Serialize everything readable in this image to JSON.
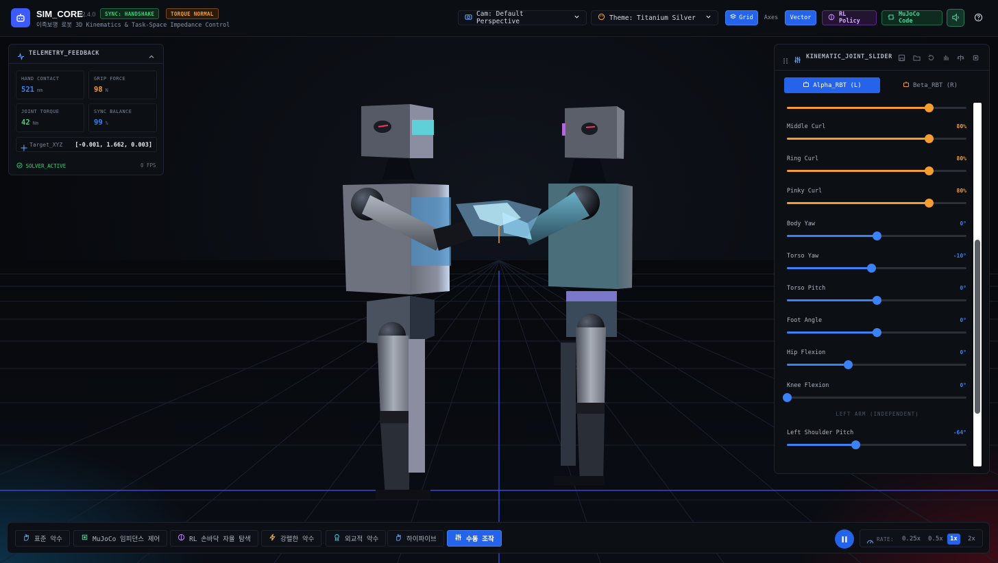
{
  "header": {
    "app_name": "SIM_CORE",
    "version": "v2.4.0",
    "subtitle": "이족보행 로봇 3D Kinematics & Task-Space Impedance Control",
    "sync_badge": "SYNC: HANDSHAKE",
    "torque_badge": "TORQUE NORMAL",
    "camera_select": "Cam: Default Perspective",
    "theme_select": "Theme: Titanium Silver",
    "view_toggles": {
      "grid": "Grid",
      "axes": "Axes",
      "vector": "Vector"
    },
    "rl_policy_button": "RL Policy",
    "mujoco_button": "MuJoCo Code"
  },
  "telemetry": {
    "title": "TELEMETRY_FEEDBACK",
    "metrics": [
      {
        "label": "HAND CONTACT",
        "value": "521",
        "unit": "mm",
        "color": "#3b82f6"
      },
      {
        "label": "GRIP FORCE",
        "value": "98",
        "unit": "N",
        "color": "#f59e2f"
      },
      {
        "label": "JOINT TORQUE",
        "value": "42",
        "unit": "Nm",
        "color": "#34d27a"
      },
      {
        "label": "SYNC BALANCE",
        "value": "99",
        "unit": "%",
        "color": "#3b82f6"
      }
    ],
    "target_label": "Target_XYZ",
    "target_value": "[-0.001, 1.662, 0.003]",
    "solver_status": "SOLVER_ACTIVE",
    "fps": "0 FPS"
  },
  "kinematics": {
    "title": "KINEMATIC_JOINT_SLIDERS",
    "robots": {
      "alpha": "Alpha_RBT (L)",
      "beta": "Beta_RBT (R)"
    },
    "partial_slider": {
      "fraction": 0.79,
      "color": "#f59e2f"
    },
    "sliders": [
      {
        "label": "Middle Curl",
        "value": "80%",
        "fraction": 0.79,
        "color": "#f59e2f"
      },
      {
        "label": "Ring Curl",
        "value": "80%",
        "fraction": 0.79,
        "color": "#f59e2f"
      },
      {
        "label": "Pinky Curl",
        "value": "80%",
        "fraction": 0.79,
        "color": "#f59e2f"
      },
      {
        "label": "Body Yaw",
        "value": "0°",
        "fraction": 0.5,
        "color": "#3b82f6"
      },
      {
        "label": "Torso Yaw",
        "value": "-10°",
        "fraction": 0.47,
        "color": "#3b82f6"
      },
      {
        "label": "Torso Pitch",
        "value": "0°",
        "fraction": 0.5,
        "color": "#3b82f6"
      },
      {
        "label": "Foot Angle",
        "value": "0°",
        "fraction": 0.5,
        "color": "#3b82f6"
      },
      {
        "label": "Hip Flexion",
        "value": "0°",
        "fraction": 0.34,
        "color": "#3b82f6"
      },
      {
        "label": "Knee Flexion",
        "value": "0°",
        "fraction": 0.0,
        "color": "#3b82f6"
      }
    ],
    "section_label": "LEFT ARM (INDEPENDENT)",
    "arm_sliders": [
      {
        "label": "Left Shoulder Pitch",
        "value": "-64°",
        "fraction": 0.38,
        "color": "#3b82f6"
      }
    ]
  },
  "bottom": {
    "modes": [
      {
        "label": "표준 악수",
        "icon": "hand-icon"
      },
      {
        "label": "MuJoCo 임피던스 제어",
        "icon": "chip-icon"
      },
      {
        "label": "RL 손바닥 자율 탐색",
        "icon": "brain-icon"
      },
      {
        "label": "강렬한 악수",
        "icon": "bolt-icon"
      },
      {
        "label": "외교적 악수",
        "icon": "award-icon"
      },
      {
        "label": "하이파이브",
        "icon": "hand-icon"
      },
      {
        "label": "수동 조작",
        "icon": "sliders-icon"
      }
    ],
    "active_mode": "수동 조작",
    "rate_label": "RATE:",
    "rates": [
      "0.25x",
      "0.5x",
      "1x",
      "2x"
    ],
    "active_rate": "1x"
  }
}
